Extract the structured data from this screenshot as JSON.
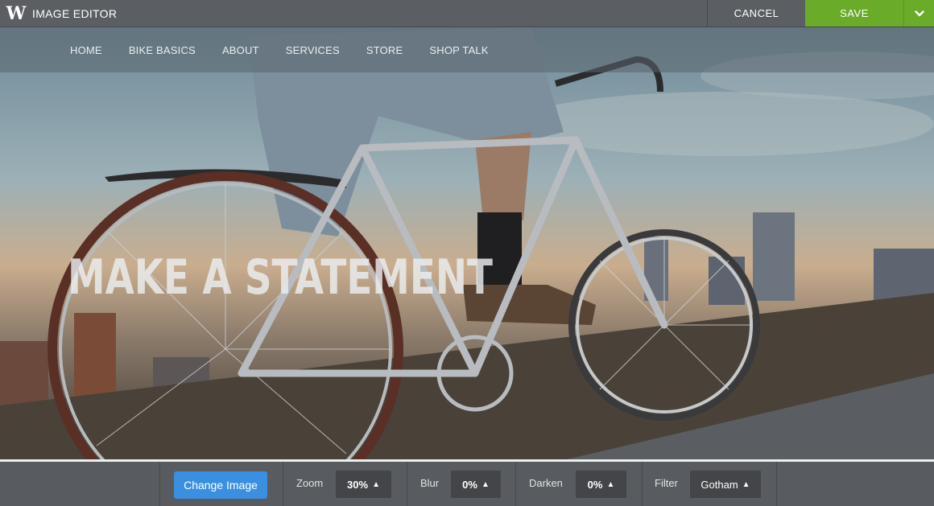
{
  "topbar": {
    "logo": "W",
    "title": "IMAGE EDITOR",
    "cancel_label": "CANCEL",
    "save_label": "SAVE",
    "more_icon": "chevron-down-icon"
  },
  "site_nav": {
    "items": [
      "HOME",
      "BIKE BASICS",
      "ABOUT",
      "SERVICES",
      "STORE",
      "SHOP TALK"
    ]
  },
  "hero": {
    "headline": "MAKE A STATEMENT"
  },
  "toolbar": {
    "change_image_label": "Change Image",
    "zoom": {
      "label": "Zoom",
      "value": "30%"
    },
    "blur": {
      "label": "Blur",
      "value": "0%"
    },
    "darken": {
      "label": "Darken",
      "value": "0%"
    },
    "filter": {
      "label": "Filter",
      "value": "Gotham"
    }
  },
  "colors": {
    "save": "#6aab2a",
    "change_image": "#3b8fe0",
    "toolbar": "#585b5f",
    "topbar": "#5b5e62"
  }
}
